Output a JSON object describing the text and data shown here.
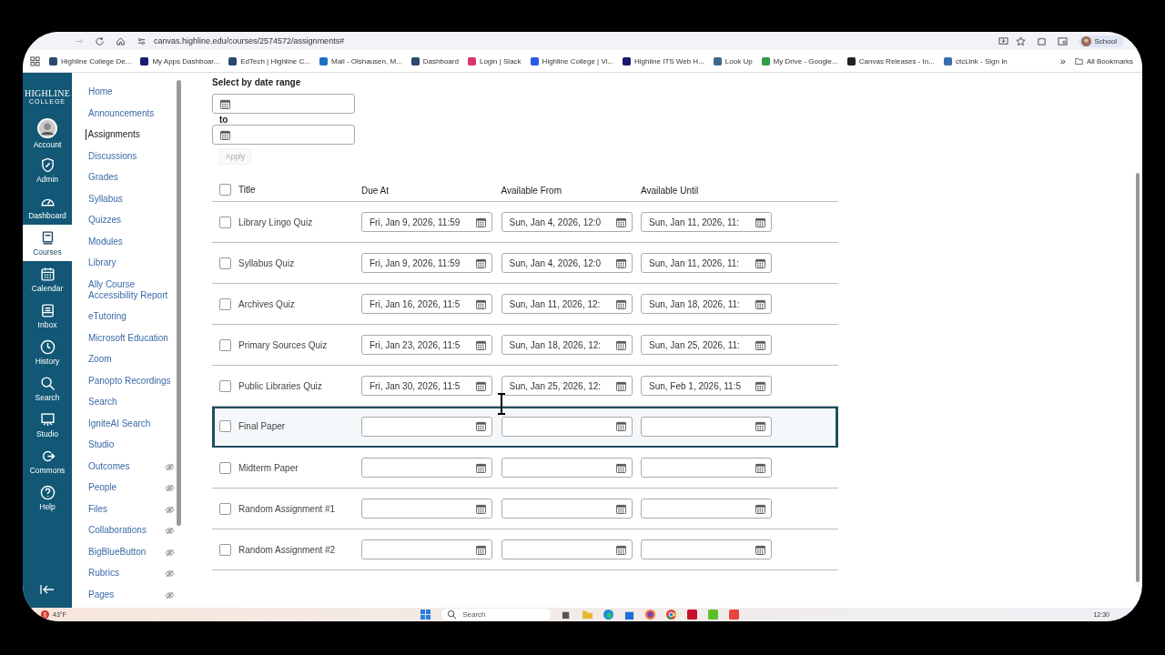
{
  "browser": {
    "url": "canvas.highline.edu/courses/2574572/assignments#",
    "profile": "School",
    "bookmarks": [
      {
        "label": "Highline College De...",
        "color": "#2b4a6f"
      },
      {
        "label": "My Apps Dashboar...",
        "color": "#1a1a6e"
      },
      {
        "label": "EdTech | Highline C...",
        "color": "#2b4a6f"
      },
      {
        "label": "Mail - Olshausen, M...",
        "color": "#1e6fc2"
      },
      {
        "label": "Dashboard",
        "color": "#2b4a6f"
      },
      {
        "label": "Login | Slack",
        "color": "#d9346f"
      },
      {
        "label": "Highline College | Vi...",
        "color": "#2d5be3"
      },
      {
        "label": "Highline ITS Web H...",
        "color": "#1a1a6e"
      },
      {
        "label": "Look Up",
        "color": "#3d6a8a"
      },
      {
        "label": "My Drive - Google...",
        "color": "#2f9e44"
      },
      {
        "label": "Canvas Releases - In...",
        "color": "#222222"
      },
      {
        "label": "ctcLink - Sign In",
        "color": "#3a6fb0"
      }
    ],
    "more": "»",
    "all_bookmarks": "All Bookmarks"
  },
  "global_nav": {
    "logo_top": "HIGHLINE",
    "logo_bottom": "COLLEGE",
    "items": [
      {
        "label": "Account",
        "kind": "avatar",
        "selected": false
      },
      {
        "label": "Admin",
        "kind": "shield",
        "selected": false
      },
      {
        "label": "Dashboard",
        "kind": "gauge",
        "selected": false
      },
      {
        "label": "Courses",
        "kind": "book",
        "selected": true
      },
      {
        "label": "Calendar",
        "kind": "calendar",
        "selected": false
      },
      {
        "label": "Inbox",
        "kind": "inbox",
        "selected": false
      },
      {
        "label": "History",
        "kind": "clock",
        "selected": false
      },
      {
        "label": "Search",
        "kind": "search",
        "selected": false
      },
      {
        "label": "Studio",
        "kind": "studio",
        "selected": false
      },
      {
        "label": "Commons",
        "kind": "commons",
        "selected": false
      },
      {
        "label": "Help",
        "kind": "help",
        "selected": false
      }
    ]
  },
  "course_nav": [
    {
      "label": "Home",
      "selected": false,
      "hidden": false
    },
    {
      "label": "Announcements",
      "selected": false,
      "hidden": false
    },
    {
      "label": "Assignments",
      "selected": true,
      "hidden": false
    },
    {
      "label": "Discussions",
      "selected": false,
      "hidden": false
    },
    {
      "label": "Grades",
      "selected": false,
      "hidden": false
    },
    {
      "label": "Syllabus",
      "selected": false,
      "hidden": false
    },
    {
      "label": "Quizzes",
      "selected": false,
      "hidden": false
    },
    {
      "label": "Modules",
      "selected": false,
      "hidden": false
    },
    {
      "label": "Library",
      "selected": false,
      "hidden": false
    },
    {
      "label": "Ally Course Accessibility Report",
      "selected": false,
      "hidden": false
    },
    {
      "label": "eTutoring",
      "selected": false,
      "hidden": false
    },
    {
      "label": "Microsoft Education",
      "selected": false,
      "hidden": false
    },
    {
      "label": "Zoom",
      "selected": false,
      "hidden": false
    },
    {
      "label": "Panopto Recordings",
      "selected": false,
      "hidden": false
    },
    {
      "label": "Search",
      "selected": false,
      "hidden": false
    },
    {
      "label": "IgniteAI Search",
      "selected": false,
      "hidden": false
    },
    {
      "label": "Studio",
      "selected": false,
      "hidden": false
    },
    {
      "label": "Outcomes",
      "selected": false,
      "hidden": true
    },
    {
      "label": "People",
      "selected": false,
      "hidden": true
    },
    {
      "label": "Files",
      "selected": false,
      "hidden": true
    },
    {
      "label": "Collaborations",
      "selected": false,
      "hidden": true
    },
    {
      "label": "BigBlueButton",
      "selected": false,
      "hidden": true
    },
    {
      "label": "Rubrics",
      "selected": false,
      "hidden": true
    },
    {
      "label": "Pages",
      "selected": false,
      "hidden": true
    }
  ],
  "date_range": {
    "heading": "Select by date range",
    "to": "to",
    "apply": {
      "label": "Apply",
      "disabled": true
    }
  },
  "table": {
    "select_all_checked": false,
    "columns": [
      "Title",
      "Due At",
      "Available From",
      "Available Until"
    ],
    "rows": [
      {
        "title": "Library Lingo Quiz",
        "checked": false,
        "selected": false,
        "dates": [
          "Fri, Jan 9, 2026, 11:59",
          "Sun, Jan 4, 2026, 12:0",
          "Sun, Jan 11, 2026, 11:"
        ]
      },
      {
        "title": "Syllabus Quiz",
        "checked": false,
        "selected": false,
        "dates": [
          "Fri, Jan 9, 2026, 11:59",
          "Sun, Jan 4, 2026, 12:0",
          "Sun, Jan 11, 2026, 11:"
        ]
      },
      {
        "title": "Archives Quiz",
        "checked": false,
        "selected": false,
        "dates": [
          "Fri, Jan 16, 2026, 11:5",
          "Sun, Jan 11, 2026, 12:",
          "Sun, Jan 18, 2026, 11:"
        ]
      },
      {
        "title": "Primary Sources Quiz",
        "checked": false,
        "selected": false,
        "dates": [
          "Fri, Jan 23, 2026, 11:5",
          "Sun, Jan 18, 2026, 12:",
          "Sun, Jan 25, 2026, 11:"
        ]
      },
      {
        "title": "Public Libraries Quiz",
        "checked": false,
        "selected": false,
        "dates": [
          "Fri, Jan 30, 2026, 11:5",
          "Sun, Jan 25, 2026, 12:",
          "Sun, Feb 1, 2026, 11:5"
        ]
      },
      {
        "title": "Final Paper",
        "checked": false,
        "selected": true,
        "dates": []
      },
      {
        "title": "Midterm Paper",
        "checked": false,
        "selected": false,
        "dates": []
      },
      {
        "title": "Random Assignment #1",
        "checked": false,
        "selected": false,
        "dates": []
      },
      {
        "title": "Random Assignment #2",
        "checked": false,
        "selected": false,
        "dates": []
      }
    ]
  },
  "taskbar": {
    "weather_badge": "6",
    "temperature": "43°F",
    "search_placeholder": "Search",
    "time": "12:30"
  }
}
